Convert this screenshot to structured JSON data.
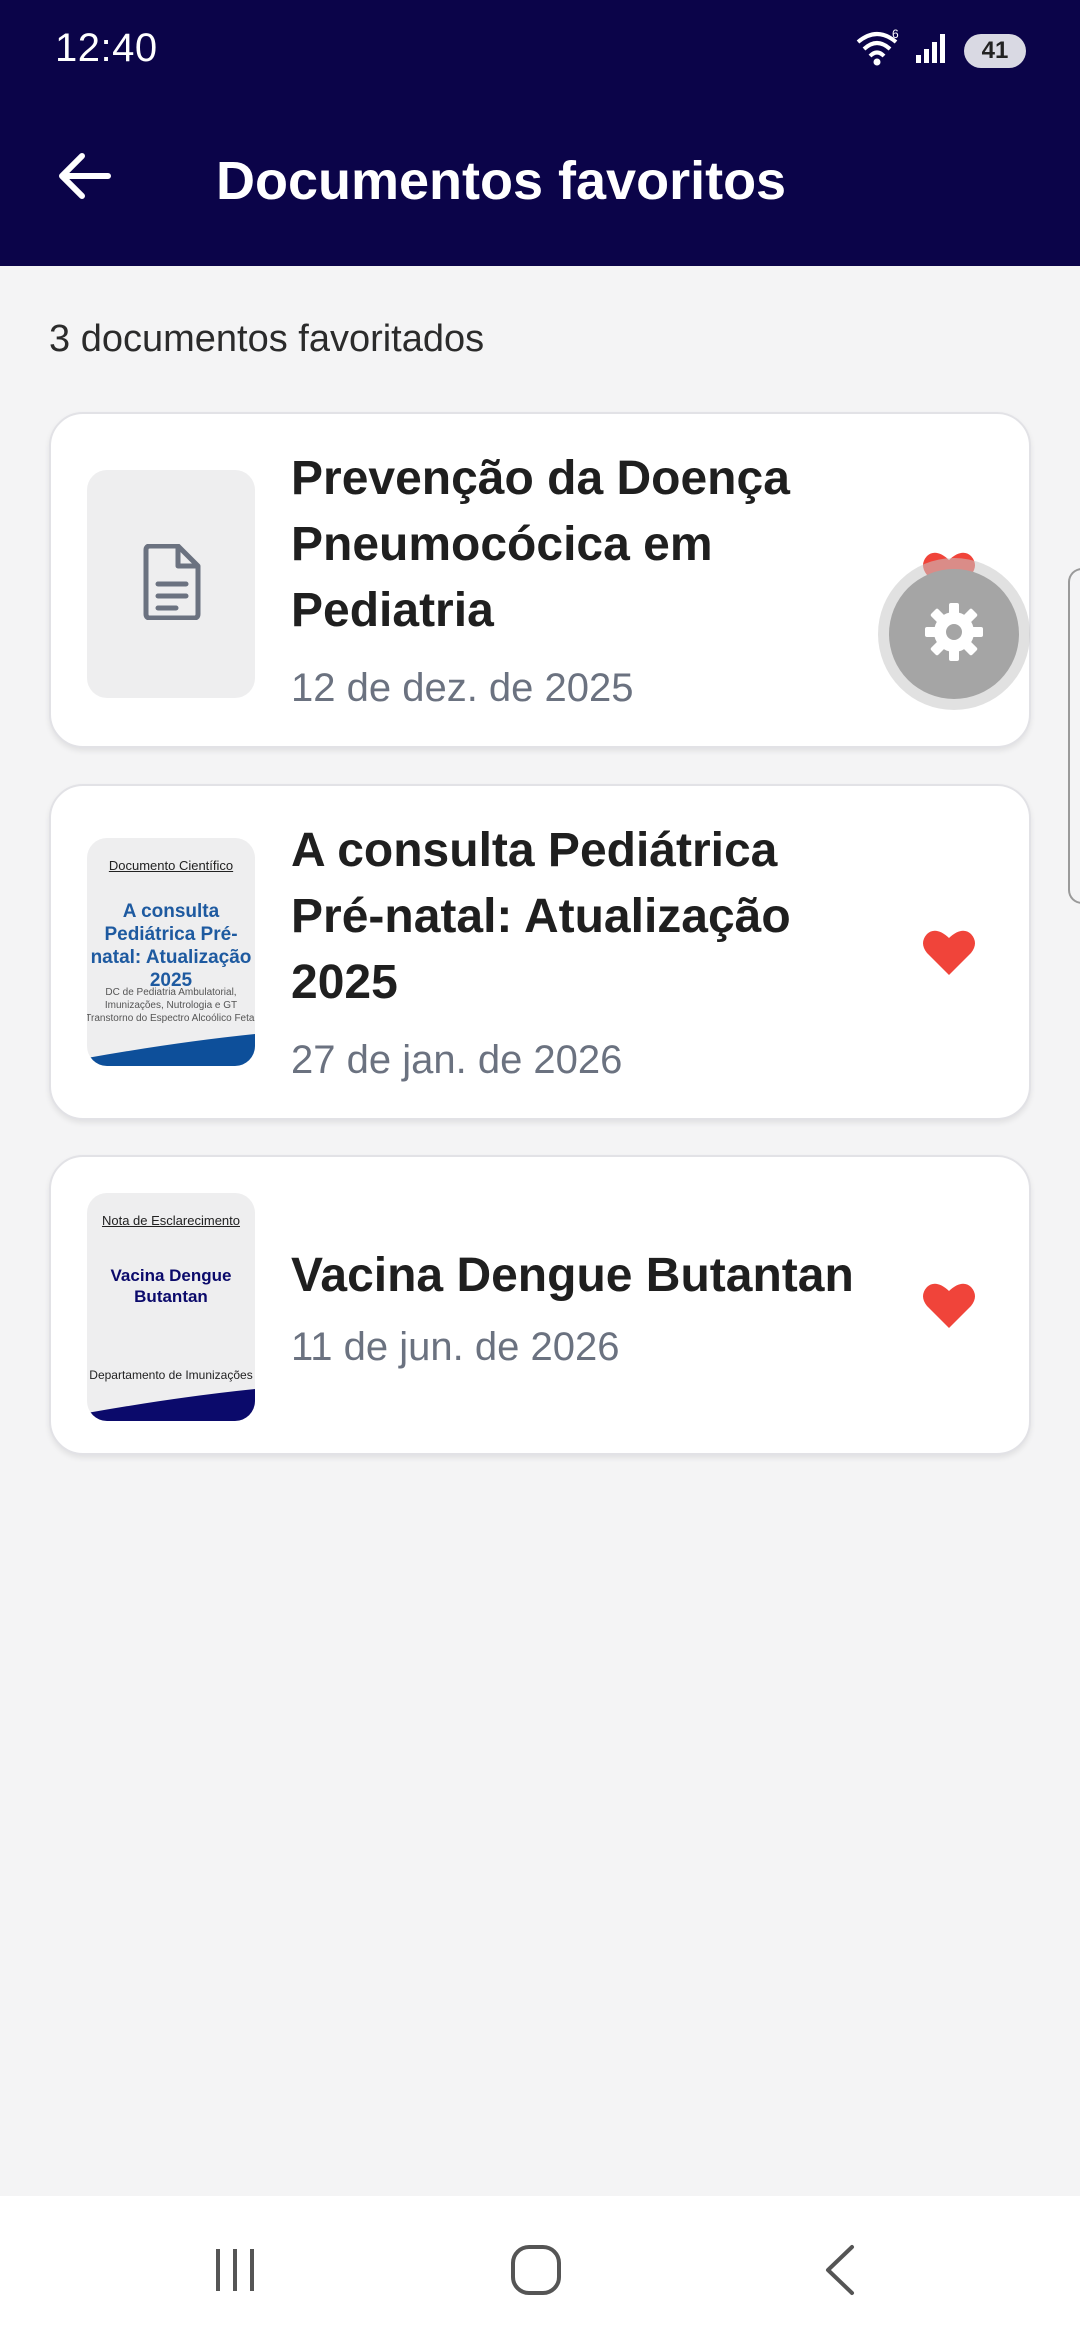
{
  "status": {
    "time": "12:40",
    "battery": "41",
    "icons": [
      "wifi-icon",
      "signal-icon",
      "battery-icon"
    ]
  },
  "appbar": {
    "title": "Documentos favoritos",
    "back_icon": "arrow-left-icon"
  },
  "summary": {
    "count_text": "3 documentos favoritados"
  },
  "documents": [
    {
      "title_lines": [
        "Prevenção da Doença",
        "Pneumocócica em",
        "Pediatria"
      ],
      "date": "12 de dez. de 2025",
      "thumbnail": "document-icon"
    },
    {
      "title_lines": [
        "A consulta Pediátrica",
        "Pré-natal: Atualização",
        "2025"
      ],
      "date": "27 de jan. de 2026",
      "thumbnail_text": {
        "top": "Documento Científico",
        "title": "A consulta Pediátrica Pré-natal: Atualização 2025",
        "small": "DC de Pediatria Ambulatorial, Imunizações, Nutrologia e GT Transtorno do Espectro Alcoólico Fetal"
      }
    },
    {
      "title_lines": [
        "Vacina Dengue Butantan"
      ],
      "date": "11 de jun. de 2026",
      "thumbnail_text": {
        "top": "Nota de Esclarecimento",
        "title": "Vacina Dengue Butantan",
        "small": "Departamento de Imunizações"
      }
    }
  ],
  "colors": {
    "header_bg": "#0b0449",
    "heart": "#f0443a",
    "page_bg": "#f4f4f5"
  }
}
